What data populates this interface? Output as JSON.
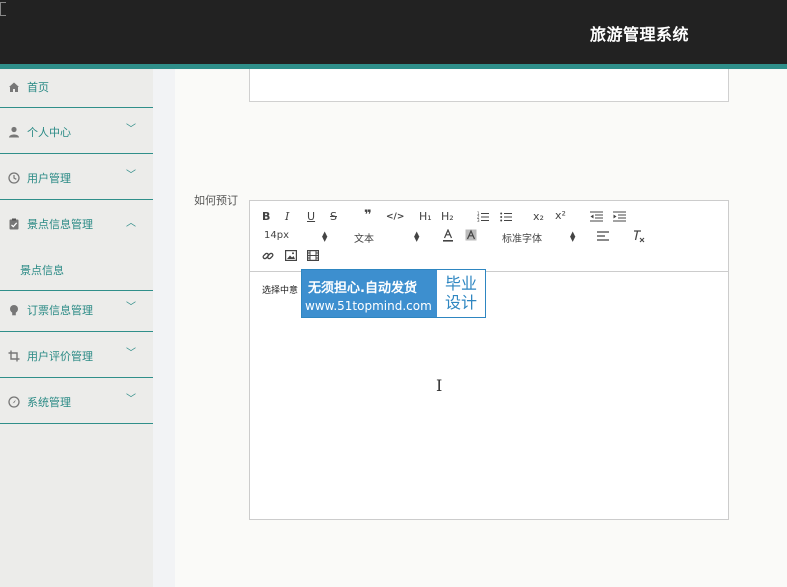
{
  "header": {
    "title": "旅游管理系统"
  },
  "sidebar": {
    "items": [
      {
        "label": "首页",
        "icon": "home-icon",
        "has_chevron": false
      },
      {
        "label": "个人中心",
        "icon": "user-icon",
        "has_chevron": true
      },
      {
        "label": "用户管理",
        "icon": "clock-icon",
        "has_chevron": true
      },
      {
        "label": "景点信息管理",
        "icon": "clipboard-icon",
        "has_chevron": true,
        "expanded": true
      },
      {
        "label": "订票信息管理",
        "icon": "bulb-icon",
        "has_chevron": true
      },
      {
        "label": "用户评价管理",
        "icon": "crop-icon",
        "has_chevron": true
      },
      {
        "label": "系统管理",
        "icon": "compass-icon",
        "has_chevron": true
      }
    ],
    "subitem": {
      "label": "景点信息"
    }
  },
  "form": {
    "field_label": "如何预订"
  },
  "editor": {
    "toolbar": {
      "bold": "B",
      "italic": "I",
      "underline": "U",
      "strike": "S",
      "quote": "❞",
      "code": "</>",
      "h1": "H₁",
      "h2": "H₂",
      "ordered_list": "≡",
      "bullet_list": "☰",
      "subscript": "x₂",
      "superscript": "x²",
      "outdent": "⇤",
      "indent": "⇥",
      "size_value": "14px",
      "header_value": "文本",
      "font_value": "标准字体",
      "align": "≡",
      "clean": "Tx",
      "link": "🔗",
      "image": "▣",
      "video": "▦"
    },
    "content": "选择中意"
  },
  "watermark": {
    "line1": "无须担心.自动发货",
    "line2": "www.51topmind.com",
    "right": "毕业设计"
  },
  "colors": {
    "header_bg": "#222222",
    "accent": "#2f8f8a",
    "sidebar_bg": "#ececea",
    "watermark_blue": "#3d8fcf"
  }
}
